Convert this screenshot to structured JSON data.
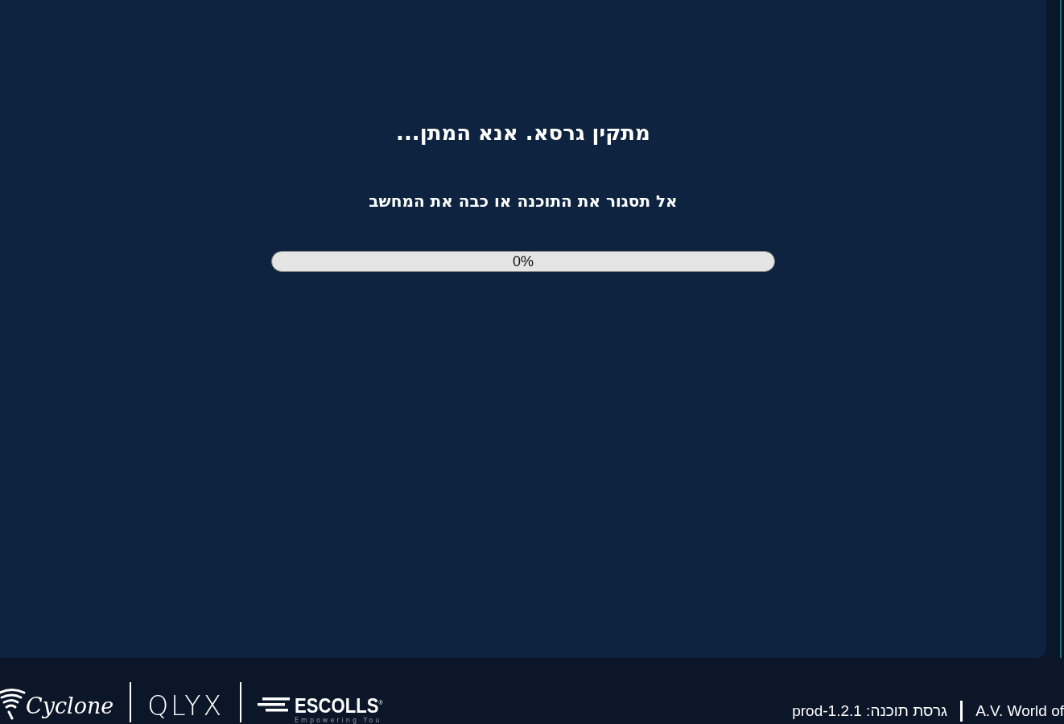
{
  "installer": {
    "title": "מתקין גרסא. אנא המתן...",
    "warning": "אל תסגור את התוכנה או כבה את המחשב",
    "progress": {
      "level": 0,
      "reading": "0%"
    }
  },
  "footer": {
    "logos": [
      {
        "kind": "escolls",
        "name": "ESCOLLS",
        "mark": "®",
        "tagline": "Empowering You"
      },
      {
        "kind": "qlyx",
        "name": "QLYX"
      },
      {
        "kind": "cyclone",
        "name": "Cyclone"
      }
    ],
    "version": "גרסת תוכנה: prod-1.2.1",
    "company": "A.V. World of"
  }
}
